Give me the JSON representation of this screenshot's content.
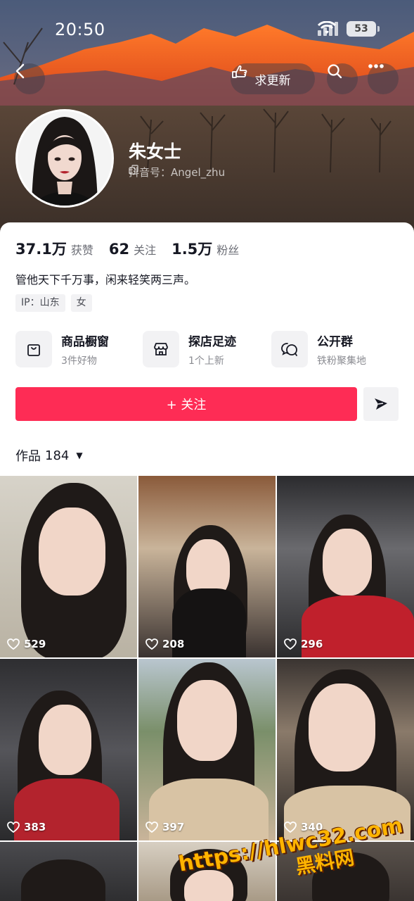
{
  "status_bar": {
    "time": "20:50",
    "battery": "53"
  },
  "header": {
    "update_label": "求更新"
  },
  "profile": {
    "nickname": "朱女士",
    "douyin_id": "抖音号：Angel_zhu",
    "stats": [
      {
        "value": "37.1万",
        "label": "获赞"
      },
      {
        "value": "62",
        "label": "关注"
      },
      {
        "value": "1.5万",
        "label": "粉丝"
      }
    ],
    "bio": "管他天下千万事，闲来轻笑两三声。",
    "tags": [
      "IP：山东",
      "女"
    ]
  },
  "features": [
    {
      "title": "商品橱窗",
      "subtitle": "3件好物",
      "icon": "shopping-bag-icon"
    },
    {
      "title": "探店足迹",
      "subtitle": "1个上新",
      "icon": "store-icon"
    },
    {
      "title": "公开群",
      "subtitle": "铁粉聚集地",
      "icon": "group-chat-icon"
    }
  ],
  "actions": {
    "follow_label": "+ 关注"
  },
  "works": {
    "label": "作品",
    "count": "184"
  },
  "videos": [
    {
      "likes": "529"
    },
    {
      "likes": "208"
    },
    {
      "likes": "296"
    },
    {
      "likes": "383"
    },
    {
      "likes": "397"
    },
    {
      "likes": "340"
    }
  ],
  "watermark": {
    "url": "https://hlwc32.com",
    "text": "黑料网"
  },
  "colors": {
    "accent": "#fe2c55",
    "text": "#161823",
    "muted": "#8a8b91"
  }
}
